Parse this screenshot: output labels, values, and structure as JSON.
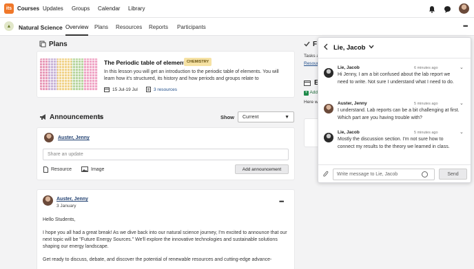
{
  "brand": {
    "logo_text": "its"
  },
  "topnav": {
    "items": [
      "Courses",
      "Updates",
      "Groups",
      "Calendar",
      "Library"
    ],
    "icons": [
      "bell-icon",
      "chat-icon",
      "avatar"
    ]
  },
  "subnav": {
    "course_title": "Natural Science",
    "tabs": [
      "Overview",
      "Plans",
      "Resources",
      "Reports",
      "Participants"
    ],
    "active_tab": "Overview",
    "more_icon": "more-icon"
  },
  "plans": {
    "section_title": "Plans",
    "card": {
      "title": "The Periodic table of elements",
      "badge": "CHEMISTRY",
      "description": "In this lesson you will get an introduction to the periodic table of elements. You will learn how it's structured, its history and how periods and groups relate to",
      "date": "15 Jul-19 Jul",
      "resources": "3 resources"
    }
  },
  "announcements": {
    "section_title": "Announcements",
    "show_label": "Show",
    "show_value": "Current",
    "author": "Auster, Jenny",
    "share_placeholder": "Share an update",
    "resource_label": "Resource",
    "image_label": "Image",
    "add_button": "Add announcement"
  },
  "post": {
    "author": "Auster, Jenny",
    "date": "3 January",
    "paragraphs": [
      "Hello Students,",
      "I hope you all had a great break! As we dive back into our natural science journey, I'm excited to announce that our next topic will be \"Future Energy Sources.\" We'll explore the innovative technologies and sustainable solutions shaping our energy landscape.",
      "Get ready to discuss, debate, and discover the potential of renewable resources and cutting-edge advance-"
    ]
  },
  "right_column": {
    "title_1": "F",
    "text_1": "Tasks a",
    "link_1": "Resour",
    "title_2": "E",
    "link_2": "Add",
    "text_2": "Here w"
  },
  "chat": {
    "contact": "Lie, Jacob",
    "messages": [
      {
        "author": "Lie, Jacob",
        "time": "6 minutes ago",
        "text": "Hi Jenny, I am a bit confused about the lab report we need to write. Not sure I understand what I need to do."
      },
      {
        "author": "Auster, Jenny",
        "time": "5 minutes ago",
        "text": "I understand. Lab reports can be a bit challenging at first. Which part are you having trouble with?"
      },
      {
        "author": "Lie, Jacob",
        "time": "5 minutes ago",
        "text": "Mostly the discussion section. I'm not sure how to connect my results to the theory we learned in class."
      }
    ],
    "input_placeholder": "Write message to Lie, Jacob",
    "send_label": "Send"
  }
}
